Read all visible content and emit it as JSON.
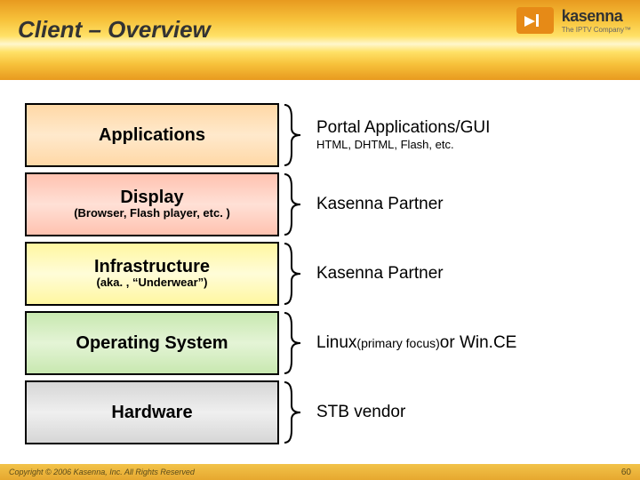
{
  "header": {
    "title": "Client – Overview",
    "logo_name": "kasenna",
    "logo_tagline": "The IPTV Company™"
  },
  "rows": [
    {
      "box_title": "Applications",
      "box_sub": "",
      "desc_main": "Portal Applications/GUI",
      "desc_sub": "HTML, DHTML, Flash, etc.",
      "desc_paren": ""
    },
    {
      "box_title": "Display",
      "box_sub": "(Browser, Flash player, etc. )",
      "desc_main": "Kasenna Partner",
      "desc_sub": "",
      "desc_paren": ""
    },
    {
      "box_title": "Infrastructure",
      "box_sub": "(aka. , “Underwear”)",
      "desc_main": "Kasenna Partner",
      "desc_sub": "",
      "desc_paren": ""
    },
    {
      "box_title": "Operating System",
      "box_sub": "",
      "desc_main": "Linux ",
      "desc_sub": "",
      "desc_paren": "(primary focus)",
      "desc_tail": " or Win.CE"
    },
    {
      "box_title": "Hardware",
      "box_sub": "",
      "desc_main": "STB vendor",
      "desc_sub": "",
      "desc_paren": ""
    }
  ],
  "footer": {
    "copyright": "Copyright © 2006 Kasenna, Inc. All Rights Reserved",
    "page": "60"
  }
}
